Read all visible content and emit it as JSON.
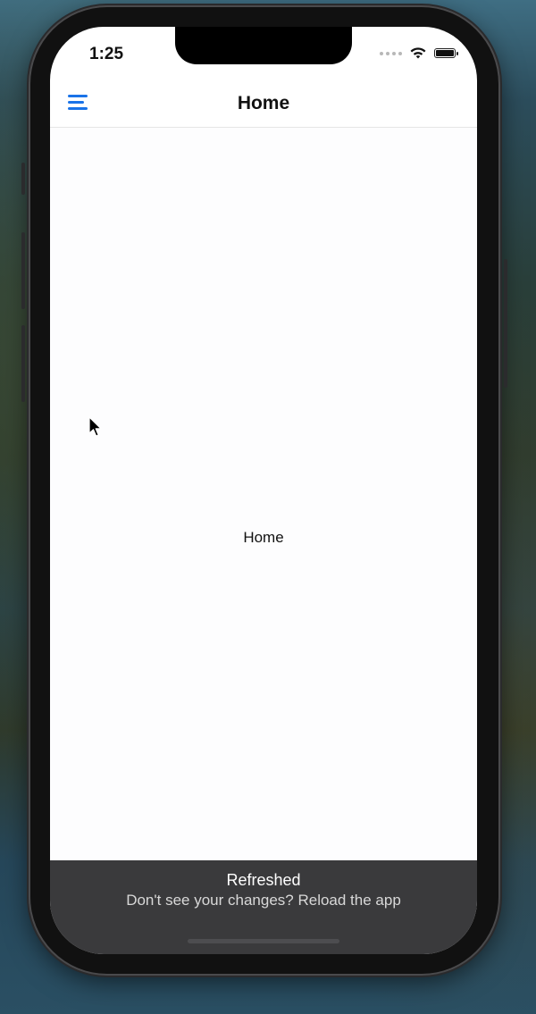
{
  "status_bar": {
    "time": "1:25",
    "battery_level": 1.0
  },
  "navbar": {
    "title": "Home",
    "menu_icon": "hamburger-menu-icon"
  },
  "content": {
    "label": "Home"
  },
  "toast": {
    "title": "Refreshed",
    "subtitle": "Don't see your changes? Reload the app"
  },
  "colors": {
    "accent": "#1a73e8",
    "toast_bg": "#3a3a3c"
  }
}
